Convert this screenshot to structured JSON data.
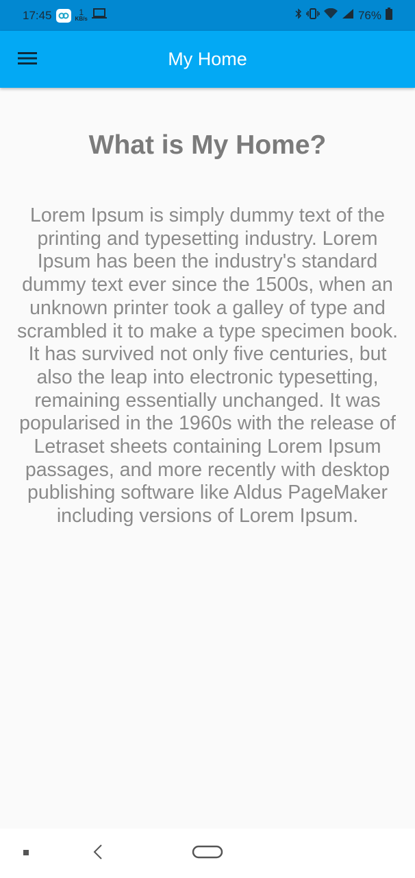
{
  "status_bar": {
    "time": "17:45",
    "speed_value": "1",
    "speed_unit": "KB/s",
    "battery": "76%",
    "icons": [
      "app-notification-icon",
      "laptop-icon",
      "bluetooth-icon",
      "vibrate-icon",
      "wifi-icon",
      "signal-icon",
      "battery-icon"
    ]
  },
  "app_bar": {
    "title": "My Home",
    "menu_icon": "hamburger-menu-icon",
    "color": "#03a9f4"
  },
  "content": {
    "heading": "What is My Home?",
    "body": "Lorem Ipsum is simply dummy text of the printing and typesetting industry. Lorem Ipsum has been the industry's standard dummy text ever since the 1500s, when an unknown printer took a galley of type and scrambled it to make a type specimen book. It has survived not only five centuries, but also the leap into electronic typesetting, remaining essentially unchanged. It was popularised in the 1960s with the release of Letraset sheets containing Lorem Ipsum passages, and more recently with desktop publishing software like Aldus PageMaker including versions of Lorem Ipsum."
  },
  "nav_bar": {
    "icons": [
      "recents-icon",
      "back-icon",
      "home-icon"
    ]
  }
}
